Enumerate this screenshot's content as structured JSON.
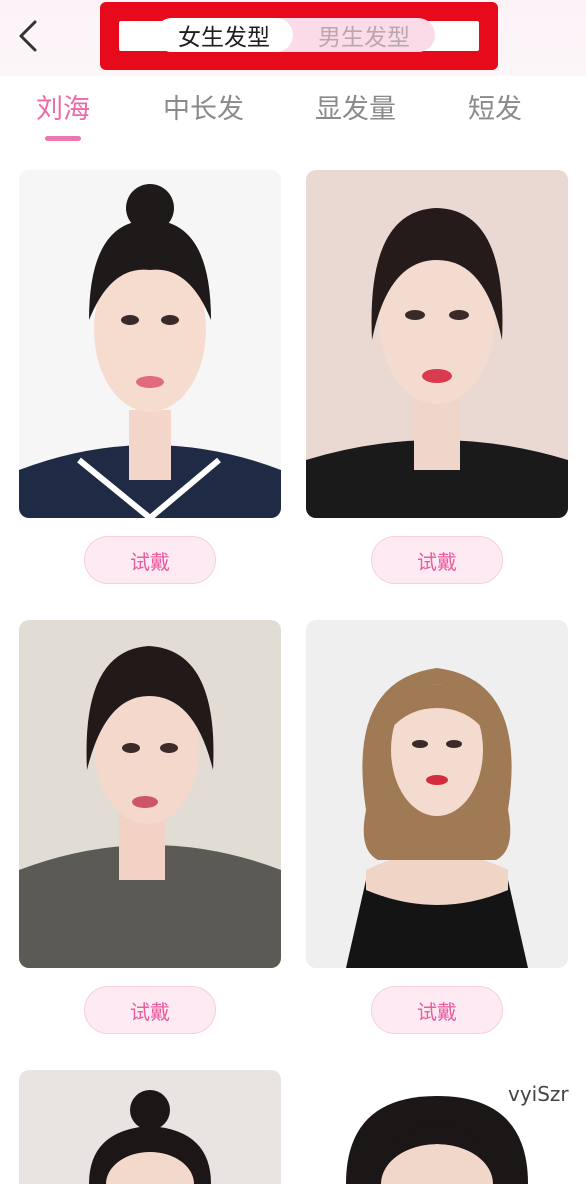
{
  "header": {
    "back_icon": "chevron-left-icon",
    "segments": {
      "female": "女生发型",
      "male": "男生发型"
    }
  },
  "tabs": [
    "刘海",
    "中长发",
    "显发量",
    "短发"
  ],
  "cards": [
    {
      "try_label": "试戴"
    },
    {
      "try_label": "试戴"
    },
    {
      "try_label": "试戴"
    },
    {
      "try_label": "试戴"
    }
  ],
  "watermark": "vyiSzr",
  "colors": {
    "accent": "#ec6aa5",
    "highlight_border": "#e60a1a",
    "segment_bg": "#fcdbe9",
    "button_bg": "#fdeaf3"
  }
}
